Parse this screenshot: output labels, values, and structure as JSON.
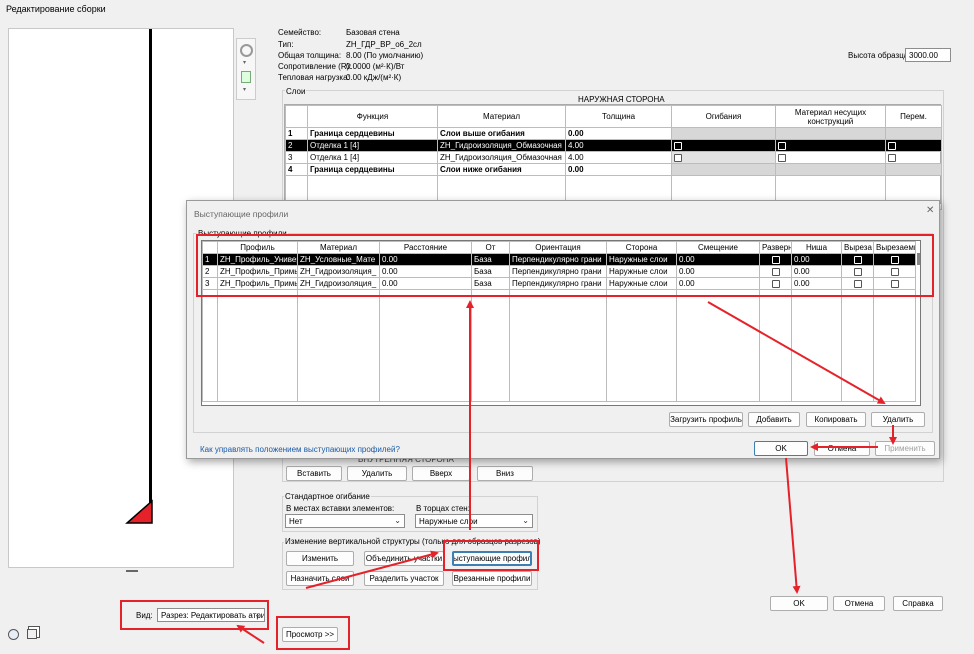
{
  "window": {
    "title": "Редактирование сборки"
  },
  "props": {
    "family_label": "Семейство:",
    "family_value": "Базовая стена",
    "type_label": "Тип:",
    "type_value": "ZH_ГДР_ВР_о6_2сл",
    "thick_label": "Общая толщина:",
    "thick_value": "8.00 (По умолчанию)",
    "res_label": "Сопротивление (R):",
    "res_value": "0.0000 (м²·К)/Вт",
    "heat_label": "Тепловая нагрузка:",
    "heat_value": "0.00 кДж/(м²·К)",
    "sample_label": "Высота образца:",
    "sample_value": "3000.00"
  },
  "layers": {
    "group_label": "Слои",
    "outer_side": "НАРУЖНАЯ СТОРОНА",
    "inner_side": "ВНУТРЕННЯЯ СТОРОНА",
    "headers": [
      "Функция",
      "Материал",
      "Толщина",
      "Огибания",
      "Материал несущих конструкций",
      "Перем."
    ],
    "rows": [
      {
        "n": "1",
        "func": "Граница сердцевины",
        "mat": "Слои выше огибания",
        "thick": "0.00"
      },
      {
        "n": "2",
        "func": "Отделка 1 [4]",
        "mat": "ZH_Гидроизоляция_Обмазочная",
        "thick": "4.00"
      },
      {
        "n": "3",
        "func": "Отделка 1 [4]",
        "mat": "ZH_Гидроизоляция_Обмазочная",
        "thick": "4.00"
      },
      {
        "n": "4",
        "func": "Граница сердцевины",
        "mat": "Слои ниже огибания",
        "thick": "0.00"
      }
    ]
  },
  "layer_buttons": {
    "insert": "Вставить",
    "delete": "Удалить",
    "up": "Вверх",
    "down": "Вниз"
  },
  "wrapping": {
    "group_label": "Стандартное огибание",
    "at_inserts_label": "В местах вставки элементов:",
    "at_inserts_value": "Нет",
    "at_ends_label": "В торцах стен:",
    "at_ends_value": "Наружные слои"
  },
  "vertical": {
    "group_label": "Изменение вертикальной структуры (только для образцов разрезов)",
    "modify": "Изменить",
    "merge": "Объединить участки",
    "sweeps": "Выступающие профили",
    "assign": "Назначить слои",
    "split": "Разделить участок",
    "reveals": "Врезанные профили"
  },
  "main_buttons": {
    "ok": "OK",
    "cancel": "Отмена",
    "help": "Справка"
  },
  "view": {
    "label": "Вид:",
    "value": "Разрез: Редактировать атри",
    "preview": "Просмотр >>"
  },
  "dialog": {
    "title": "Выступающие профили",
    "group_label": "Выступающие профили",
    "headers": [
      "Профиль",
      "Материал",
      "Расстояние",
      "От",
      "Ориентация",
      "Сторона",
      "Смещение",
      "Разверн",
      "Ниша",
      "Выреза",
      "Вырезаемы"
    ],
    "rows": [
      {
        "n": "1",
        "profile": "ZH_Профиль_Универ",
        "material": "ZH_Условные_Мате",
        "distance": "0.00",
        "from": "База",
        "orientation": "Перпендикулярно грани",
        "side": "Наружные слои",
        "offset": "0.00",
        "niche": "0.00"
      },
      {
        "n": "2",
        "profile": "ZH_Профиль_Примы",
        "material": "ZH_Гидроизоляция_",
        "distance": "0.00",
        "from": "База",
        "orientation": "Перпендикулярно грани",
        "side": "Наружные слои",
        "offset": "0.00",
        "niche": "0.00"
      },
      {
        "n": "3",
        "profile": "ZH_Профиль_Примы",
        "material": "ZH_Гидроизоляция_",
        "distance": "0.00",
        "from": "База",
        "orientation": "Перпендикулярно грани",
        "side": "Наружные слои",
        "offset": "0.00",
        "niche": "0.00"
      }
    ],
    "load": "Загрузить профиль",
    "add": "Добавить",
    "copy": "Копировать",
    "delete": "Удалить",
    "link": "Как управлять положением выступающих профилей?",
    "ok": "OK",
    "cancel": "Отмена",
    "apply": "Применить"
  },
  "accent": "#e52229"
}
